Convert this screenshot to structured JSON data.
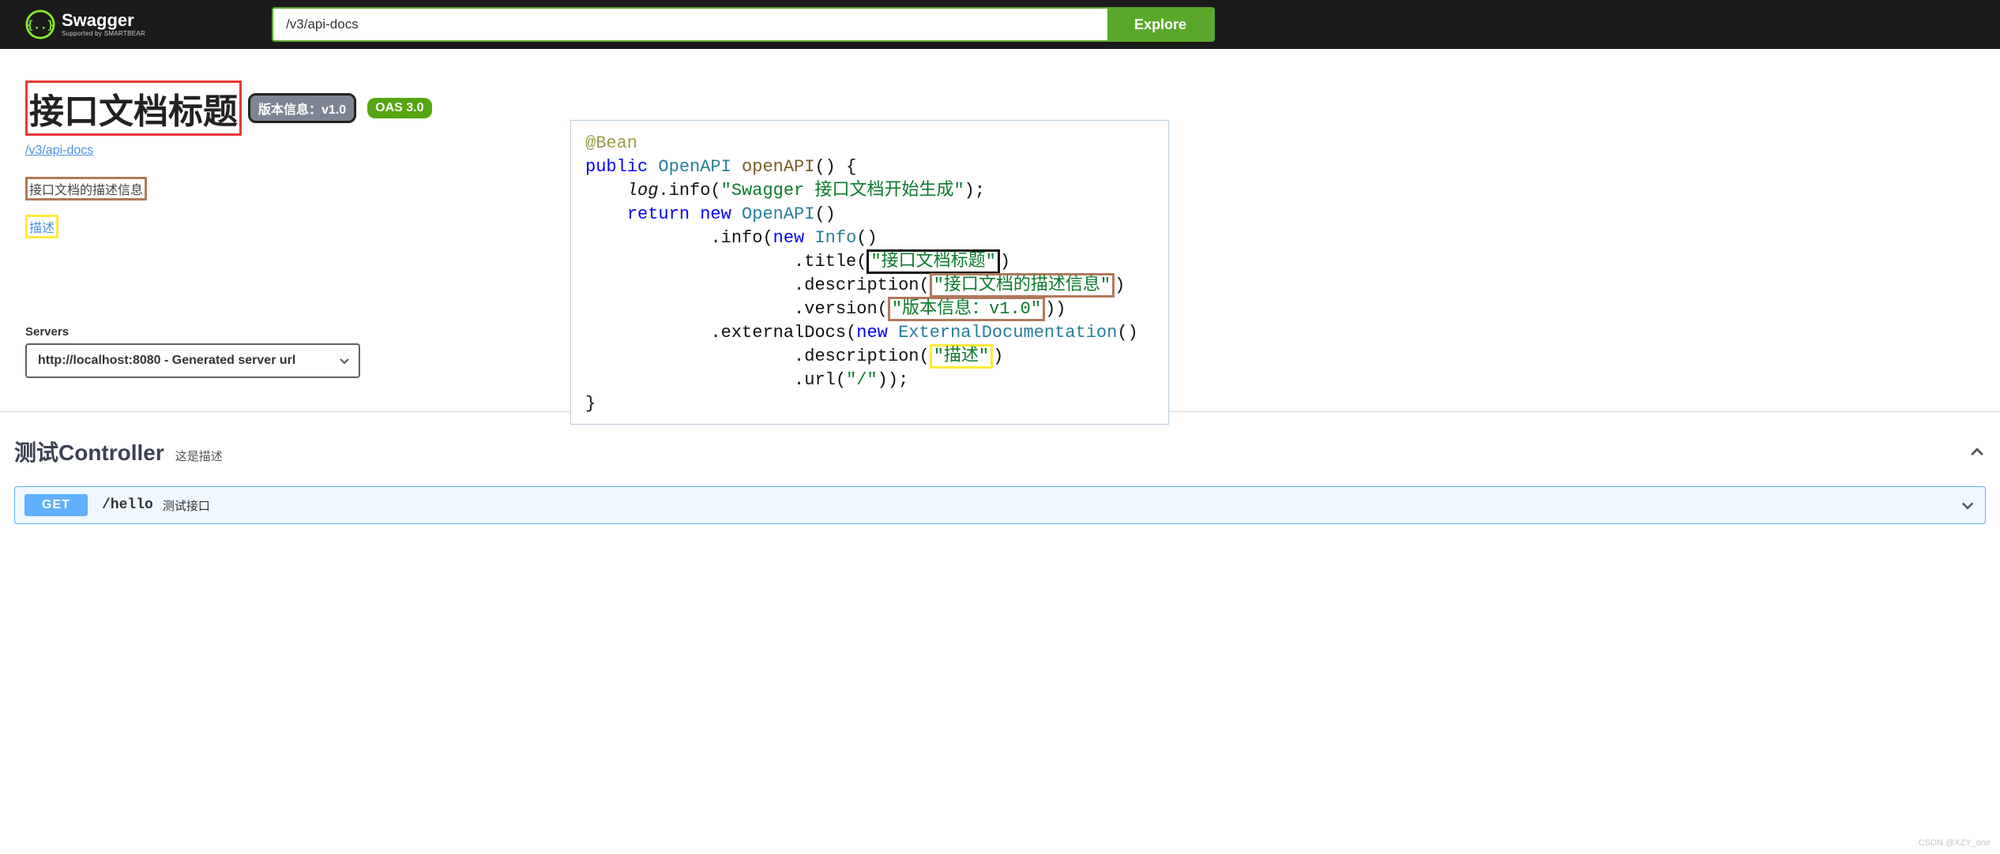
{
  "topbar": {
    "brand_main": "Swagger",
    "brand_sub": "Supported by SMARTBEAR",
    "url_value": "/v3/api-docs",
    "explore_label": "Explore"
  },
  "info": {
    "title": "接口文档标题",
    "version_badge": "版本信息：v1.0",
    "oas_badge": "OAS 3.0",
    "docs_link": "/v3/api-docs",
    "description": "接口文档的描述信息",
    "external_doc": "描述"
  },
  "servers": {
    "label": "Servers",
    "selected": "http://localhost:8080 - Generated server url"
  },
  "tag": {
    "name": "测试Controller",
    "desc": "这是描述"
  },
  "op": {
    "method": "GET",
    "path": "/hello",
    "summary": "测试接口"
  },
  "code": {
    "ann": "@Bean",
    "kw_public": "public",
    "type_openapi": "OpenAPI",
    "fn_openapi": "openAPI",
    "log_var": "log",
    "log_call": ".info(",
    "log_str": "\"Swagger 接口文档开始生成\"",
    "return": "return",
    "new": "new",
    "type_info": "Info",
    "title_m": ".title(",
    "title_str": "\"接口文档标题\"",
    "desc_m": ".description(",
    "desc_str": "\"接口文档的描述信息\"",
    "ver_m": ".version(",
    "ver_str": "\"版本信息：v1.0\"",
    "extdocs_m": ".externalDocs(",
    "type_ext": "ExternalDocumentation",
    "extdesc_m": ".description(",
    "extdesc_str": "\"描述\"",
    "url_m": ".url(",
    "url_str": "\"/\""
  },
  "watermark": "CSDN @XZY_one"
}
